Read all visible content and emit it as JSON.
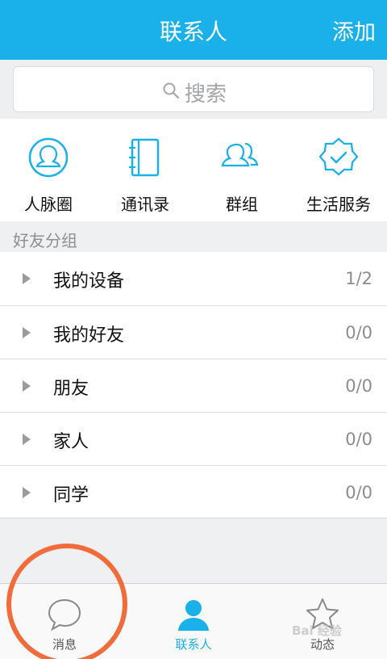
{
  "header": {
    "title": "联系人",
    "add_label": "添加"
  },
  "search": {
    "placeholder": "搜索"
  },
  "quick": [
    {
      "label": "人脉圈",
      "icon": "people-circle-icon"
    },
    {
      "label": "通讯录",
      "icon": "address-book-icon"
    },
    {
      "label": "群组",
      "icon": "group-icon"
    },
    {
      "label": "生活服务",
      "icon": "life-service-badge-icon"
    }
  ],
  "section": {
    "title": "好友分组"
  },
  "groups": [
    {
      "name": "我的设备",
      "count": "1/2"
    },
    {
      "name": "我的好友",
      "count": "0/0"
    },
    {
      "name": "朋友",
      "count": "0/0"
    },
    {
      "name": "家人",
      "count": "0/0"
    },
    {
      "name": "同学",
      "count": "0/0"
    }
  ],
  "tabs": [
    {
      "label": "消息",
      "icon": "chat-bubble-icon"
    },
    {
      "label": "联系人",
      "icon": "contact-person-icon",
      "active": true
    },
    {
      "label": "动态",
      "icon": "star-icon"
    }
  ],
  "colors": {
    "accent": "#1ab0ea",
    "highlight_circle": "#f26b3a"
  },
  "watermark": {
    "text": "Bai 经验"
  }
}
